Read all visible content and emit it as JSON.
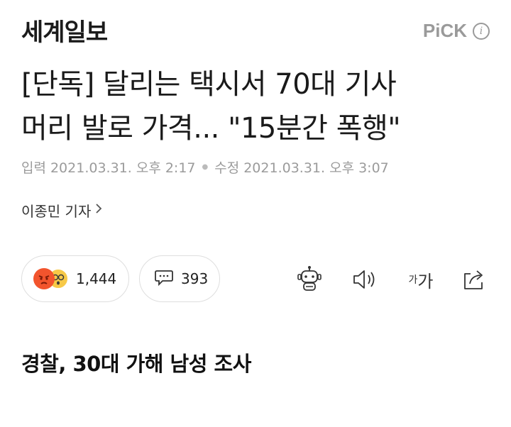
{
  "header": {
    "brand": "세계일보",
    "pick_label": "PiCK",
    "info_icon": "info-icon"
  },
  "article": {
    "headline_line1": "[단독] 달리는 택시서 70대 기사",
    "headline_line2": "머리 발로 가격... \"15분간 폭행\"",
    "input_label": "입력",
    "input_time": "2021.03.31. 오후 2:17",
    "modified_label": "수정",
    "modified_time": "2021.03.31. 오후 3:07",
    "reporter": "이종민 기자",
    "subhead": "경찰, 30대 가해 남성 조사"
  },
  "actions": {
    "reaction_count": "1,444",
    "comment_count": "393",
    "font_size_small": "가",
    "font_size_large": "가"
  },
  "colors": {
    "angry_emoji": "#f2542d",
    "surprised_emoji": "#f7c948",
    "muted_text": "#9b9b9b"
  }
}
